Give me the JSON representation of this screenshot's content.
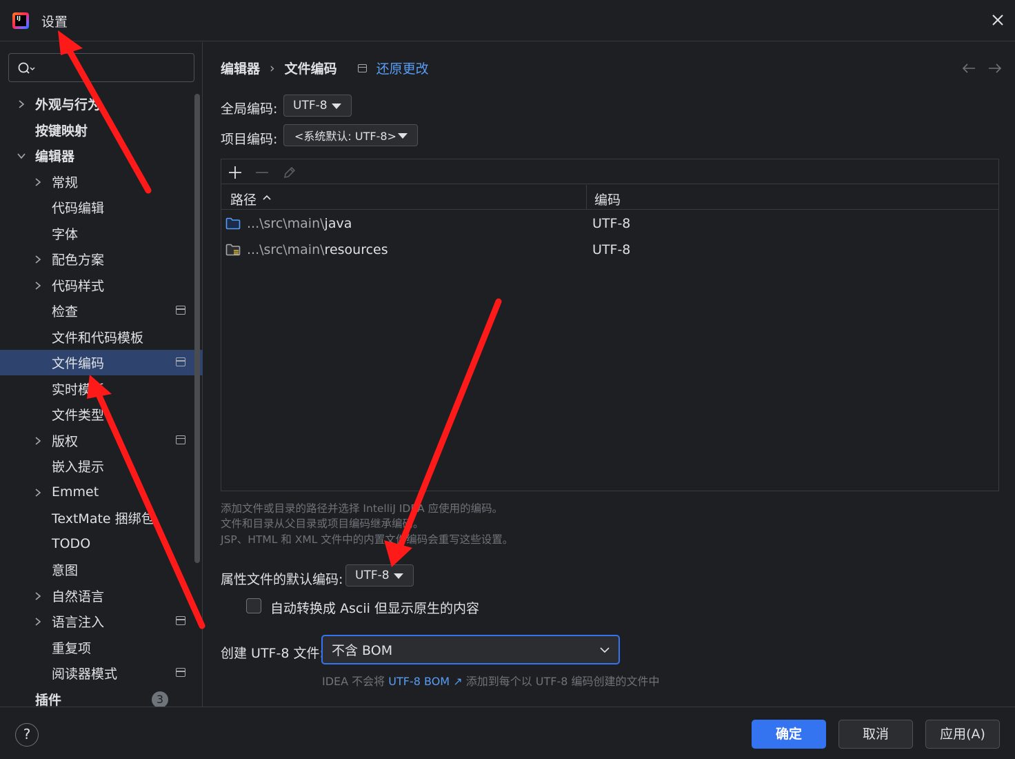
{
  "window": {
    "title": "设置"
  },
  "search": {
    "placeholder": ""
  },
  "sidebar": {
    "items": [
      {
        "label": "外观与行为"
      },
      {
        "label": "按键映射"
      },
      {
        "label": "编辑器"
      },
      {
        "label": "常规"
      },
      {
        "label": "代码编辑"
      },
      {
        "label": "字体"
      },
      {
        "label": "配色方案"
      },
      {
        "label": "代码样式"
      },
      {
        "label": "检查"
      },
      {
        "label": "文件和代码模板"
      },
      {
        "label": "文件编码"
      },
      {
        "label": "实时模板"
      },
      {
        "label": "文件类型"
      },
      {
        "label": "版权"
      },
      {
        "label": "嵌入提示"
      },
      {
        "label": "Emmet"
      },
      {
        "label": "TextMate 捆绑包"
      },
      {
        "label": "TODO"
      },
      {
        "label": "意图"
      },
      {
        "label": "自然语言"
      },
      {
        "label": "语言注入"
      },
      {
        "label": "重复项"
      },
      {
        "label": "阅读器模式"
      },
      {
        "label": "插件",
        "badge": "3"
      }
    ]
  },
  "breadcrumb": {
    "parent": "编辑器",
    "sep": "›",
    "current": "文件编码",
    "reset": "还原更改"
  },
  "global_encoding": {
    "label": "全局编码:",
    "value": "UTF-8"
  },
  "project_encoding": {
    "label": "项目编码:",
    "value": "<系统默认: UTF-8>"
  },
  "table": {
    "columns": [
      "路径",
      "编码"
    ],
    "rows": [
      {
        "path_prefix": "...\\src\\main\\",
        "path_name": "java",
        "encoding": "UTF-8"
      },
      {
        "path_prefix": "...\\src\\main\\",
        "path_name": "resources",
        "encoding": "UTF-8"
      }
    ]
  },
  "hints": [
    "添加文件或目录的路径并选择 IntelliJ IDEA 应使用的编码。",
    "文件和目录从父目录或项目编码继承编码。",
    "JSP、HTML 和 XML 文件中的内置文件编码会重写这些设置。"
  ],
  "properties_encoding": {
    "label": "属性文件的默认编码:",
    "value": "UTF-8"
  },
  "ascii_checkbox": {
    "label": "自动转换成 Ascii 但显示原生的内容",
    "checked": false
  },
  "bom": {
    "label": "创建 UTF-8 文件:",
    "value": "不含 BOM",
    "hint_before": "IDEA 不会将",
    "hint_link": "UTF-8 BOM ↗",
    "hint_after": "添加到每个以 UTF-8 编码创建的文件中"
  },
  "footer": {
    "help": "?",
    "ok": "确定",
    "cancel": "取消",
    "apply": "应用(A)"
  },
  "colors": {
    "accent": "#3574f0",
    "selection": "#2e436e",
    "link": "#589df6",
    "annotation": "#ff1a1a"
  }
}
